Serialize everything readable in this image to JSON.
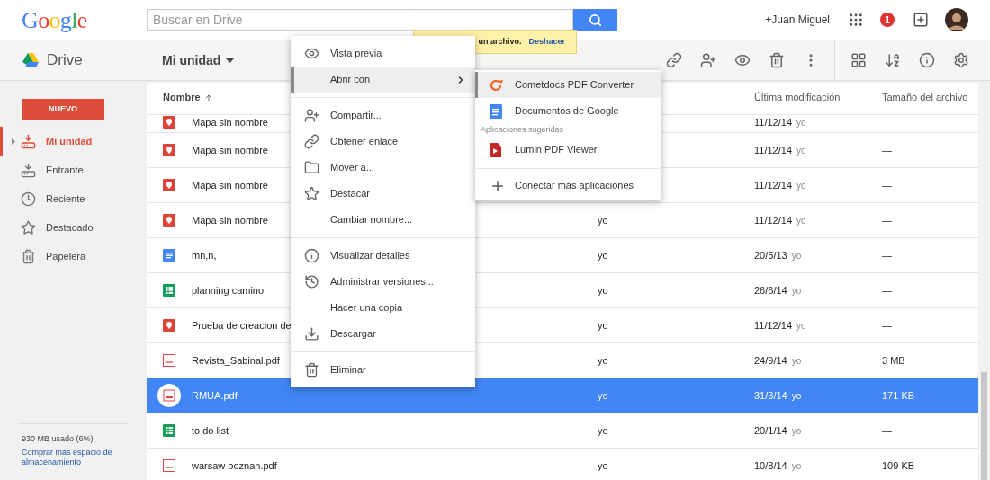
{
  "header": {
    "logo": "Google",
    "search": {
      "placeholder": "Buscar en Drive"
    },
    "user": "+Juan Miguel",
    "notifications": "1"
  },
  "toast": {
    "message": "un archivo.",
    "action": "Deshacer"
  },
  "toolbar": {
    "app": "Drive",
    "location": "Mi unidad"
  },
  "sidebar": {
    "new_button": "NUEVO",
    "items": [
      {
        "label": "Mi unidad",
        "selected": true
      },
      {
        "label": "Entrante",
        "selected": false
      },
      {
        "label": "Reciente",
        "selected": false
      },
      {
        "label": "Destacado",
        "selected": false
      },
      {
        "label": "Papelera",
        "selected": false
      }
    ],
    "storage": "930 MB usado (6%)",
    "storage_link": "Comprar más espacio de almacenamiento"
  },
  "table": {
    "columns": [
      "Nombre",
      "Última modificación",
      "Tamaño del archivo"
    ],
    "partial_row": {
      "kind": "map",
      "name": "Mapa sin nombre",
      "date": "11/12/14",
      "modifier": "yo"
    },
    "rows": [
      {
        "kind": "map",
        "name": "Mapa sin nombre",
        "date": "11/12/14",
        "modifier": "yo",
        "size": "—",
        "selected": false
      },
      {
        "kind": "map",
        "name": "Mapa sin nombre",
        "date": "11/12/14",
        "modifier": "yo",
        "size": "—",
        "selected": false
      },
      {
        "kind": "map",
        "name": "Mapa sin nombre",
        "owner": "yo",
        "date": "11/12/14",
        "modifier": "yo",
        "size": "—",
        "selected": false
      },
      {
        "kind": "doc",
        "name": "mn,n,",
        "owner": "yo",
        "date": "20/5/13",
        "modifier": "yo",
        "size": "—",
        "selected": false
      },
      {
        "kind": "sheet",
        "name": "planning camino",
        "owner": "yo",
        "date": "26/6/14",
        "modifier": "yo",
        "size": "—",
        "selected": false
      },
      {
        "kind": "map",
        "name": "Prueba de creacion de",
        "owner": "yo",
        "date": "11/12/14",
        "modifier": "yo",
        "size": "—",
        "selected": false
      },
      {
        "kind": "pdf",
        "name": "Revista_Sabinal.pdf",
        "owner": "yo",
        "date": "24/9/14",
        "modifier": "yo",
        "size": "3 MB",
        "selected": false
      },
      {
        "kind": "pdf",
        "name": "RMUA.pdf",
        "owner": "yo",
        "date": "31/3/14",
        "modifier": "yo",
        "size": "171 KB",
        "selected": true
      },
      {
        "kind": "sheet",
        "name": "to do list",
        "owner": "yo",
        "date": "20/1/14",
        "modifier": "yo",
        "size": "—",
        "selected": false
      },
      {
        "kind": "pdf",
        "name": "warsaw poznan.pdf",
        "owner": "yo",
        "date": "10/8/14",
        "modifier": "yo",
        "size": "109 KB",
        "selected": false
      }
    ]
  },
  "context_menu": {
    "groups": [
      [
        {
          "label": "Vista previa",
          "highlighted": false,
          "submenu": false
        },
        {
          "label": "Abrir con",
          "highlighted": true,
          "submenu": true
        }
      ],
      [
        {
          "label": "Compartir...",
          "highlighted": false,
          "submenu": false
        },
        {
          "label": "Obtener enlace",
          "highlighted": false,
          "submenu": false
        },
        {
          "label": "Mover a...",
          "highlighted": false,
          "submenu": false
        },
        {
          "label": "Destacar",
          "highlighted": false,
          "submenu": false
        },
        {
          "label": "Cambiar nombre...",
          "highlighted": false,
          "submenu": false
        }
      ],
      [
        {
          "label": "Visualizar detalles",
          "highlighted": false,
          "submenu": false
        },
        {
          "label": "Administrar versiones...",
          "highlighted": false,
          "submenu": false
        },
        {
          "label": "Hacer una copia",
          "highlighted": false,
          "submenu": false
        },
        {
          "label": "Descargar",
          "highlighted": false,
          "submenu": false
        }
      ],
      [
        {
          "label": "Eliminar",
          "highlighted": false,
          "submenu": false
        }
      ]
    ]
  },
  "submenu": {
    "groups": [
      [
        {
          "kind": "app",
          "label": "Cometdocs PDF Converter",
          "highlighted": true
        },
        {
          "kind": "app",
          "label": "Documentos de Google",
          "highlighted": false
        },
        {
          "kind": "heading",
          "label": "Aplicaciones sugeridas"
        },
        {
          "kind": "app",
          "label": "Lumin PDF Viewer",
          "highlighted": false
        }
      ],
      [
        {
          "kind": "app",
          "label": "Conectar más aplicaciones",
          "highlighted": false
        }
      ]
    ]
  }
}
